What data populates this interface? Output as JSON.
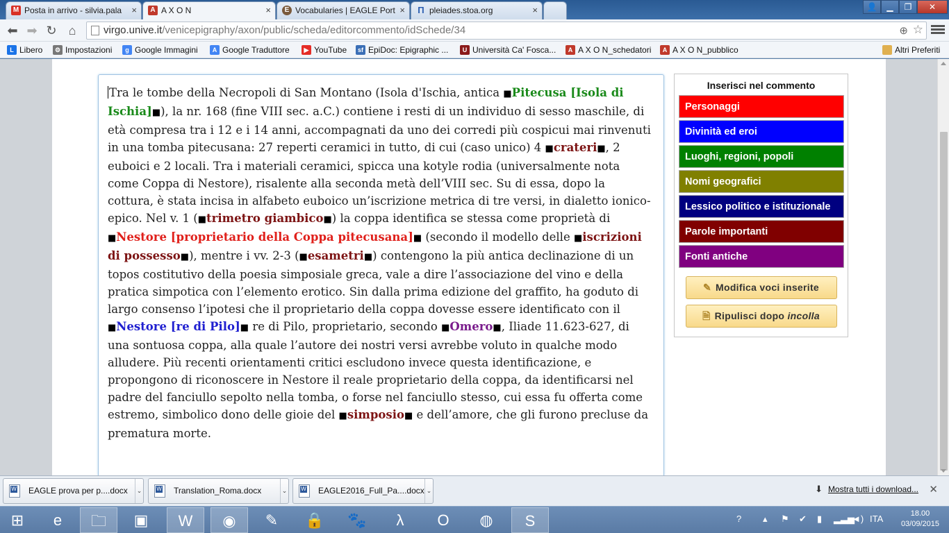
{
  "tabs": [
    {
      "title": "Posta in arrivo - silvia.pala",
      "icon": "gmail-icon",
      "color": "#d93025"
    },
    {
      "title": "A X O N",
      "icon": "axon-icon",
      "color": "#c0392b",
      "active": true
    },
    {
      "title": "Vocabularies | EAGLE Port",
      "icon": "eagle-icon",
      "color": "#7a5a3c"
    },
    {
      "title": "pleiades.stoa.org",
      "icon": "pleiades-icon",
      "color": "#2a5db0"
    }
  ],
  "toolbar": {
    "url_host": "virgo.unive.it",
    "url_path": "/venicepigraphy/axon/public/scheda/editorcommento/idSchede/34"
  },
  "bookmarks": [
    {
      "label": "Libero",
      "color": "#1a73e8"
    },
    {
      "label": "Impostazioni",
      "color": "#555555"
    },
    {
      "label": "Google Immagini",
      "color": "#4285f4"
    },
    {
      "label": "Google Traduttore",
      "color": "#4285f4"
    },
    {
      "label": "YouTube",
      "color": "#e52d27"
    },
    {
      "label": "EpiDoc: Epigraphic ...",
      "color": "#3b6fb6"
    },
    {
      "label": "Università Ca' Fosca...",
      "color": "#8b1a1a"
    },
    {
      "label": "A X O N_schedatori",
      "color": "#c0392b"
    },
    {
      "label": "A X O N_pubblico",
      "color": "#c0392b"
    },
    {
      "label": "Altri Preferiti",
      "color": "#e0b050"
    }
  ],
  "editor": {
    "p": [
      "Tra le tombe della Necropoli di San Montano (Isola d'Ischia, antica ",
      "Pitecusa [Isola di Ischia]",
      "), la nr. 168 (fine VIII sec. a.C.) contiene i resti di un individuo di sesso maschile, di età compresa tra i 12 e i 14 anni, accompagnati da uno dei corredi più cospicui mai rinvenuti in una tomba pitecusana: 27 reperti ceramici in tutto, di cui (caso unico) 4 ",
      "crateri",
      ", 2 euboici e 2 locali. Tra i materiali ceramici, spicca una kotyle rodia (universalmente nota come Coppa di Nestore), risalente alla seconda metà dell’VIII sec. Su di essa, dopo la cottura, è stata incisa in alfabeto euboico un’iscrizione metrica di tre versi, in dialetto ionico-epico. Nel v. 1 (",
      "trimetro giambico",
      ") la coppa identifica se stessa come proprietà di ",
      "Nestore [proprietario della Coppa pitecusana]",
      " (secondo il modello delle ",
      "iscrizioni di possesso",
      "), mentre i vv. 2-3 (",
      "esametri",
      ") contengono la più antica declinazione di un topos costitutivo della poesia simposiale greca, vale a dire l’associazione del vino e della pratica simpotica con l’elemento erotico. Sin dalla prima edizione del graffito, ha goduto di largo consenso l’ipotesi che il proprietario della coppa dovesse essere identificato con il ",
      "Nestore [re di Pilo]",
      " re di Pilo, proprietario, secondo ",
      "Omero",
      ", Iliade 11.623-627, di una sontuosa coppa, alla quale l’autore dei nostri versi avrebbe voluto in qualche modo alludere. Più recenti orientamenti critici escludono invece questa identificazione, e propongono di riconoscere in Nestore il reale proprietario della coppa, da identificarsi nel padre del fanciullo sepolto nella tomba, o forse nel fanciullo stesso, cui essa fu offerta come estremo, simbolico dono delle gioie del ",
      "simposio",
      " e dell’amore, che gli furono precluse da prematura morte."
    ],
    "marker": "■"
  },
  "panel": {
    "title": "Inserisci nel commento",
    "categories": [
      {
        "label": "Personaggi",
        "color": "#ff0000"
      },
      {
        "label": "Divinità ed eroi",
        "color": "#0000ff"
      },
      {
        "label": "Luoghi, regioni, popoli",
        "color": "#008000"
      },
      {
        "label": "Nomi geografici",
        "color": "#808000"
      },
      {
        "label": "Lessico politico e istituzionale",
        "color": "#000080"
      },
      {
        "label": "Parole importanti",
        "color": "#800000"
      },
      {
        "label": "Fonti antiche",
        "color": "#800080"
      }
    ],
    "modify_label": "Modifica voci inserite",
    "clean_label_prefix": "Ripulisci dopo ",
    "clean_label_em": "incolla"
  },
  "downloads": {
    "items": [
      "EAGLE prova per p....docx",
      "Translation_Roma.docx",
      "EAGLE2016_Full_Pa....docx"
    ],
    "show_all": "Mostra tutti i download..."
  },
  "taskbar": {
    "apps": [
      "ie-icon",
      "explorer-icon",
      "remote-icon",
      "word-icon",
      "chrome-icon",
      "notes-icon",
      "lock-icon",
      "gimp-icon",
      "terminal-icon",
      "opera-icon",
      "firefox-icon",
      "skype-icon"
    ],
    "lang": "ITA",
    "time": "18.00",
    "date": "03/09/2015"
  }
}
